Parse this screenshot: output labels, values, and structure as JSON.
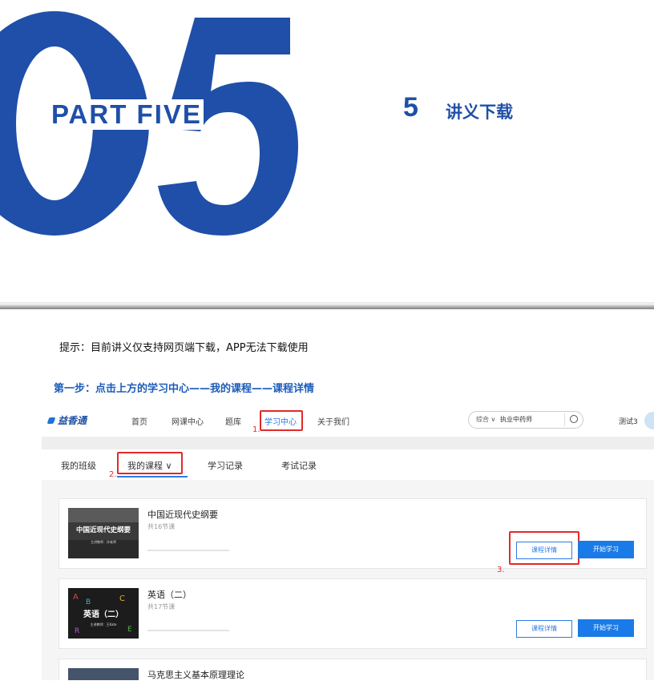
{
  "header": {
    "big_number": "05",
    "part_label": "PART FIVE",
    "section_number": "5",
    "section_title": "讲义下载"
  },
  "instructions": {
    "tip": "提示：目前讲义仅支持网页端下载，APP无法下载使用",
    "step1": "第一步：点击上方的学习中心——我的课程——课程详情"
  },
  "site": {
    "logo": "益香通",
    "nav": [
      "首页",
      "网课中心",
      "题库",
      "学习中心",
      "关于我们"
    ],
    "search": {
      "category": "综合",
      "value": "执业中药师"
    },
    "user": "测试3",
    "tabs": [
      "我的班级",
      "我的课程",
      "学习记录",
      "考试记录"
    ],
    "annotations": [
      "1.",
      "2.",
      "3."
    ],
    "courses": [
      {
        "title": "中国近现代史纲要",
        "lessons": "共16节课",
        "thumb_text": "中国近现代史纲要",
        "thumb_sub": "主讲教师：孙老师",
        "detail_label": "课程详情",
        "start_label": "开始学习"
      },
      {
        "title": "英语（二）",
        "lessons": "共17节课",
        "thumb_text": "英语（二）",
        "thumb_sub": "主讲教师：王Kate",
        "detail_label": "课程详情",
        "start_label": "开始学习"
      },
      {
        "title": "马克思主义基本原理理论"
      }
    ],
    "colors": {
      "brand_blue": "#1f4fa8",
      "link_blue": "#2e7ce6",
      "highlight_red": "#e12a2a"
    }
  }
}
